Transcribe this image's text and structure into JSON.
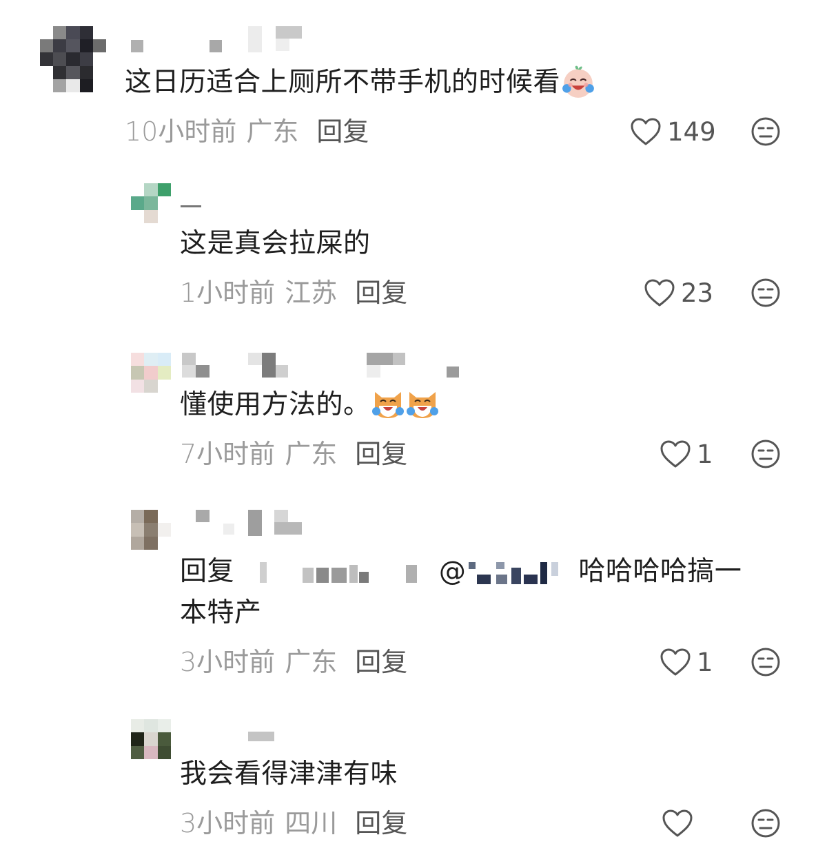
{
  "comments": [
    {
      "text": "这日历适合上厕所不带手机的时候看",
      "emoji": "crying-laughing-face-icon",
      "time": "10小时前",
      "location": "广东",
      "reply_label": "回复",
      "likes": "149"
    },
    {
      "text": "这是真会拉屎的",
      "time": "1小时前",
      "location": "江苏",
      "reply_label": "回复",
      "likes": "23"
    },
    {
      "text": "懂使用方法的。",
      "emoji": "laughing-cat-icon",
      "time": "7小时前",
      "location": "广东",
      "reply_label": "回复",
      "likes": "1"
    },
    {
      "prefix": "回复",
      "at": "@",
      "text_line1": "哈哈哈哈搞一",
      "text_line2": "本特产",
      "time": "3小时前",
      "location": "广东",
      "reply_label": "回复",
      "likes": "1"
    },
    {
      "text": "我会看得津津有味",
      "time": "3小时前",
      "location": "四川",
      "reply_label": "回复",
      "likes": ""
    }
  ],
  "icons": {
    "like": "heart-outline-icon",
    "dislike": "neutral-face-icon"
  },
  "colors": {
    "text": "#1e1e1e",
    "meta": "#9a9a9a",
    "action": "#555555"
  }
}
